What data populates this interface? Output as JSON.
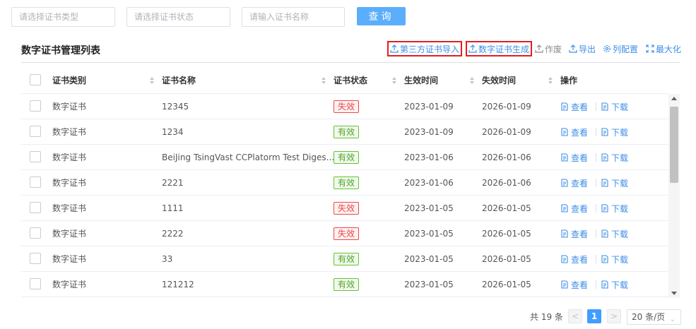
{
  "filters": {
    "cert_type_placeholder": "请选择证书类型",
    "cert_status_placeholder": "请选择证书状态",
    "cert_name_placeholder": "请输入证书名称",
    "query_label": "查询"
  },
  "list": {
    "title": "数字证书管理列表"
  },
  "toolbar": {
    "import_label": "第三方证书导入",
    "generate_label": "数字证书生成",
    "revoke_label": "作废",
    "export_label": "导出",
    "columns_label": "列配置",
    "maximize_label": "最大化"
  },
  "table": {
    "headers": {
      "type": "证书类别",
      "name": "证书名称",
      "status": "证书状态",
      "start": "生效时间",
      "end": "失效时间",
      "ops": "操作"
    },
    "view_label": "查看",
    "download_label": "下载",
    "rows": [
      {
        "type": "数字证书",
        "name": "12345",
        "status": "失效",
        "status_kind": "bad",
        "start": "2023-01-09",
        "end": "2026-01-09"
      },
      {
        "type": "数字证书",
        "name": "1234",
        "status": "有效",
        "status_kind": "good",
        "start": "2023-01-09",
        "end": "2026-01-09"
      },
      {
        "type": "数字证书",
        "name": "BeiJing TsingVast CCPlatorm Test Diges...",
        "status": "有效",
        "status_kind": "good",
        "start": "2023-01-06",
        "end": "2026-01-06"
      },
      {
        "type": "数字证书",
        "name": "2221",
        "status": "有效",
        "status_kind": "good",
        "start": "2023-01-06",
        "end": "2026-01-06"
      },
      {
        "type": "数字证书",
        "name": "1111",
        "status": "失效",
        "status_kind": "bad",
        "start": "2023-01-05",
        "end": "2026-01-05"
      },
      {
        "type": "数字证书",
        "name": "2222",
        "status": "失效",
        "status_kind": "bad",
        "start": "2023-01-05",
        "end": "2026-01-05"
      },
      {
        "type": "数字证书",
        "name": "33",
        "status": "有效",
        "status_kind": "good",
        "start": "2023-01-05",
        "end": "2026-01-05"
      },
      {
        "type": "数字证书",
        "name": "121212",
        "status": "有效",
        "status_kind": "good",
        "start": "2023-01-05",
        "end": "2026-01-05"
      }
    ]
  },
  "pagination": {
    "total": "共 19 条",
    "prev": "<",
    "current_page": "1",
    "next": ">",
    "page_size": "20 条/页"
  },
  "colors": {
    "primary": "#409eff",
    "query_button": "#5aaefc",
    "link": "#3d8ee9",
    "highlight_box": "#e0201f",
    "status_bad": "#e84b4b",
    "status_good": "#67c23a"
  }
}
